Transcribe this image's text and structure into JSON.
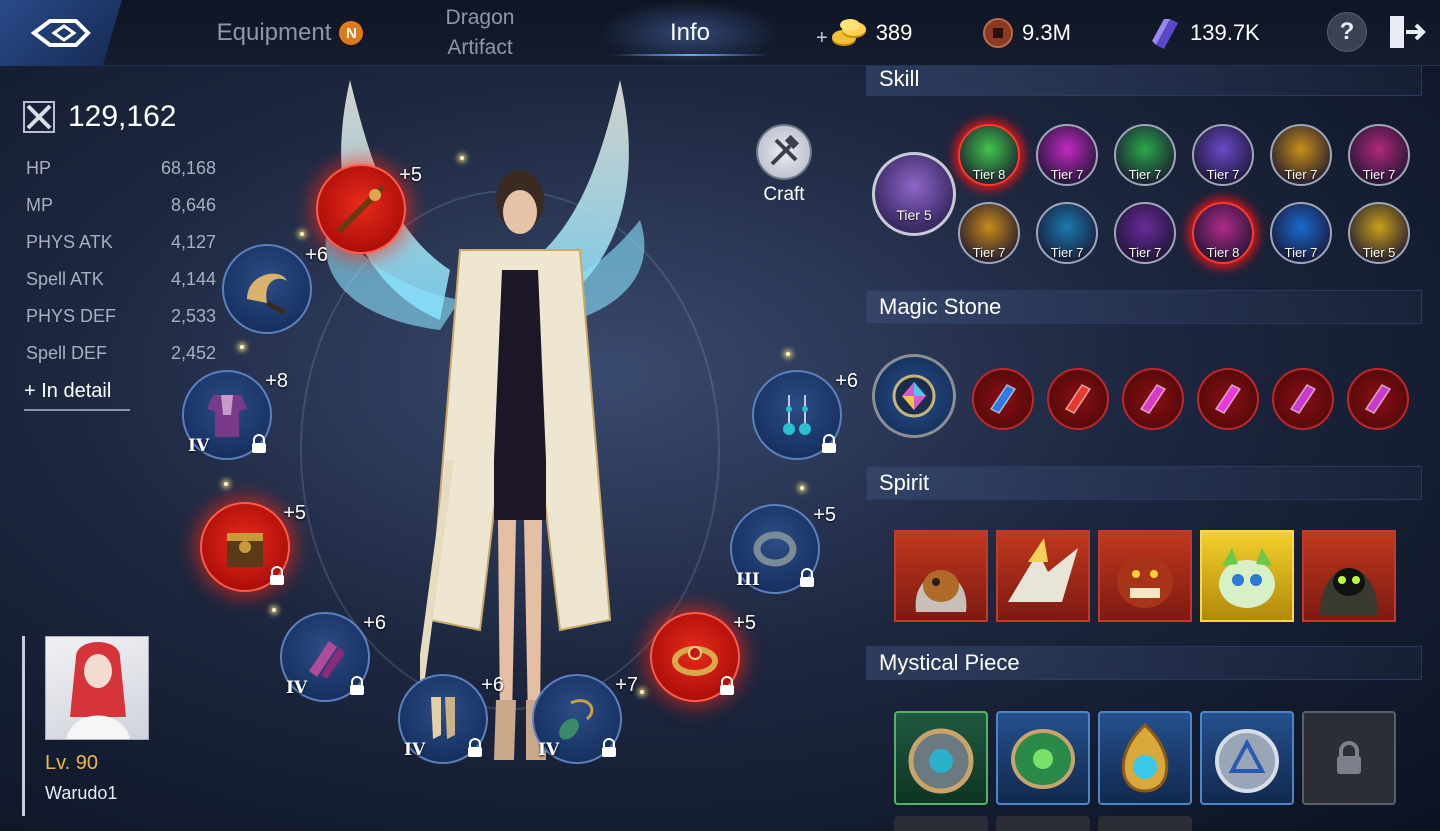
{
  "topbar": {
    "tabs": [
      {
        "label": "Equipment",
        "badge": "N"
      },
      {
        "label_line1": "Dragon",
        "label_line2": "Artifact"
      },
      {
        "label": "Info",
        "active": true
      }
    ],
    "currency": {
      "gold": "389",
      "coin": "9.3M",
      "gem": "139.7K"
    },
    "help_label": "?"
  },
  "stats": {
    "combat_power": "129,162",
    "rows": [
      {
        "label": "HP",
        "value": "68,168"
      },
      {
        "label": "MP",
        "value": "8,646"
      },
      {
        "label": "PHYS ATK",
        "value": "4,127"
      },
      {
        "label": "Spell ATK",
        "value": "4,144"
      },
      {
        "label": "PHYS DEF",
        "value": "2,533"
      },
      {
        "label": "Spell DEF",
        "value": "2,452"
      }
    ],
    "detail_link": "+ In detail"
  },
  "equipment": {
    "slots": [
      {
        "name": "staff",
        "plus": "+5",
        "roman": "",
        "red": true,
        "locked": false
      },
      {
        "name": "horn",
        "plus": "+6",
        "roman": "",
        "red": false,
        "locked": false
      },
      {
        "name": "armor",
        "plus": "+8",
        "roman": "IV",
        "red": false,
        "locked": true
      },
      {
        "name": "belt",
        "plus": "+5",
        "roman": "",
        "red": true,
        "locked": true
      },
      {
        "name": "gloves",
        "plus": "+6",
        "roman": "IV",
        "red": false,
        "locked": true
      },
      {
        "name": "boots",
        "plus": "+6",
        "roman": "IV",
        "red": false,
        "locked": true
      },
      {
        "name": "necklace",
        "plus": "+7",
        "roman": "IV",
        "red": false,
        "locked": true
      },
      {
        "name": "ring-red",
        "plus": "+5",
        "roman": "",
        "red": true,
        "locked": true
      },
      {
        "name": "ring",
        "plus": "+5",
        "roman": "III",
        "red": false,
        "locked": true
      },
      {
        "name": "earrings",
        "plus": "+6",
        "roman": "",
        "red": false,
        "locked": true
      }
    ],
    "craft_label": "Craft"
  },
  "character": {
    "level": "Lv. 90",
    "name": "Warudo1"
  },
  "skill": {
    "title": "Skill",
    "main_tier": "Tier 5",
    "icons": [
      {
        "tier": "Tier 8",
        "hot": true,
        "color": "#3fc84a"
      },
      {
        "tier": "Tier 7",
        "hot": false,
        "color": "#c02ac0"
      },
      {
        "tier": "Tier 7",
        "hot": false,
        "color": "#2aa84a"
      },
      {
        "tier": "Tier 7",
        "hot": false,
        "color": "#6a4ac8"
      },
      {
        "tier": "Tier 7",
        "hot": false,
        "color": "#c8901a"
      },
      {
        "tier": "Tier 7",
        "hot": false,
        "color": "#b0287a"
      },
      {
        "tier": "Tier 7",
        "hot": false,
        "color": "#c88a1a"
      },
      {
        "tier": "Tier 7",
        "hot": false,
        "color": "#1a7ab0"
      },
      {
        "tier": "Tier 7",
        "hot": false,
        "color": "#6a2a9a"
      },
      {
        "tier": "Tier 8",
        "hot": true,
        "color": "#b02a8a"
      },
      {
        "tier": "Tier 7",
        "hot": false,
        "color": "#1a6ad0"
      },
      {
        "tier": "Tier 5",
        "hot": false,
        "color": "#c8a01a"
      }
    ]
  },
  "magic_stone": {
    "title": "Magic Stone",
    "stones": [
      {
        "color": "#2a7ae8"
      },
      {
        "color": "#e83a2a"
      },
      {
        "color": "#d83ac8"
      },
      {
        "color": "#e83ad8"
      },
      {
        "color": "#c83ad0"
      },
      {
        "color": "#c83ac8"
      }
    ]
  },
  "spirit": {
    "title": "Spirit"
  },
  "mystical_piece": {
    "title": "Mystical Piece"
  }
}
